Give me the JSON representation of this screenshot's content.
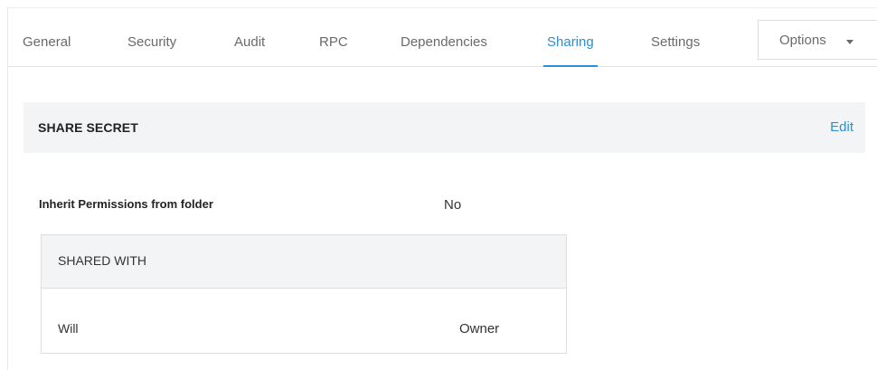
{
  "tabs": [
    {
      "label": "General"
    },
    {
      "label": "Security"
    },
    {
      "label": "Audit"
    },
    {
      "label": "RPC"
    },
    {
      "label": "Dependencies"
    },
    {
      "label": "Sharing",
      "active": true
    },
    {
      "label": "Settings"
    }
  ],
  "options_button": {
    "label": "Options",
    "icon": "caret-down-icon"
  },
  "section": {
    "title": "SHARE SECRET",
    "edit_label": "Edit"
  },
  "inherit_permissions": {
    "label": "Inherit Permissions from folder",
    "value": "No"
  },
  "shared_with": {
    "header": "SHARED WITH",
    "rows": [
      {
        "name": "Will",
        "role": "Owner"
      }
    ]
  },
  "colors": {
    "accent": "#2a8fd4",
    "header_bg": "#f3f4f6",
    "border": "#dedede"
  }
}
